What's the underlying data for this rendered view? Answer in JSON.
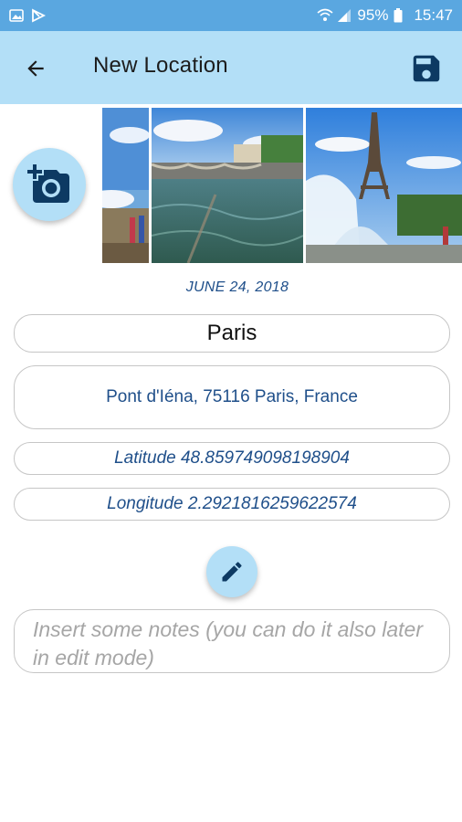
{
  "status_bar": {
    "battery": "95%",
    "time": "15:47"
  },
  "app_bar": {
    "title": "New Location",
    "back_icon": "arrow-back-icon",
    "save_icon": "save-icon"
  },
  "colors": {
    "status_bar": "#5aa7e0",
    "app_bar": "#b3dff7",
    "accent": "#1f4f8a",
    "fab": "#b3dff7",
    "icon": "#0d3a63"
  },
  "location": {
    "date": "JUNE 24, 2018",
    "name": "Paris",
    "address": "Pont d'Iéna, 75116 Paris, France",
    "latitude": "Latitude 48.859749098198904",
    "longitude": "Longitude 2.2921816259622574"
  },
  "notes": {
    "placeholder": "Insert some notes (you can do it also later in edit mode)"
  },
  "actions": {
    "add_photo_icon": "add-a-photo-icon",
    "edit_icon": "pencil-icon"
  }
}
